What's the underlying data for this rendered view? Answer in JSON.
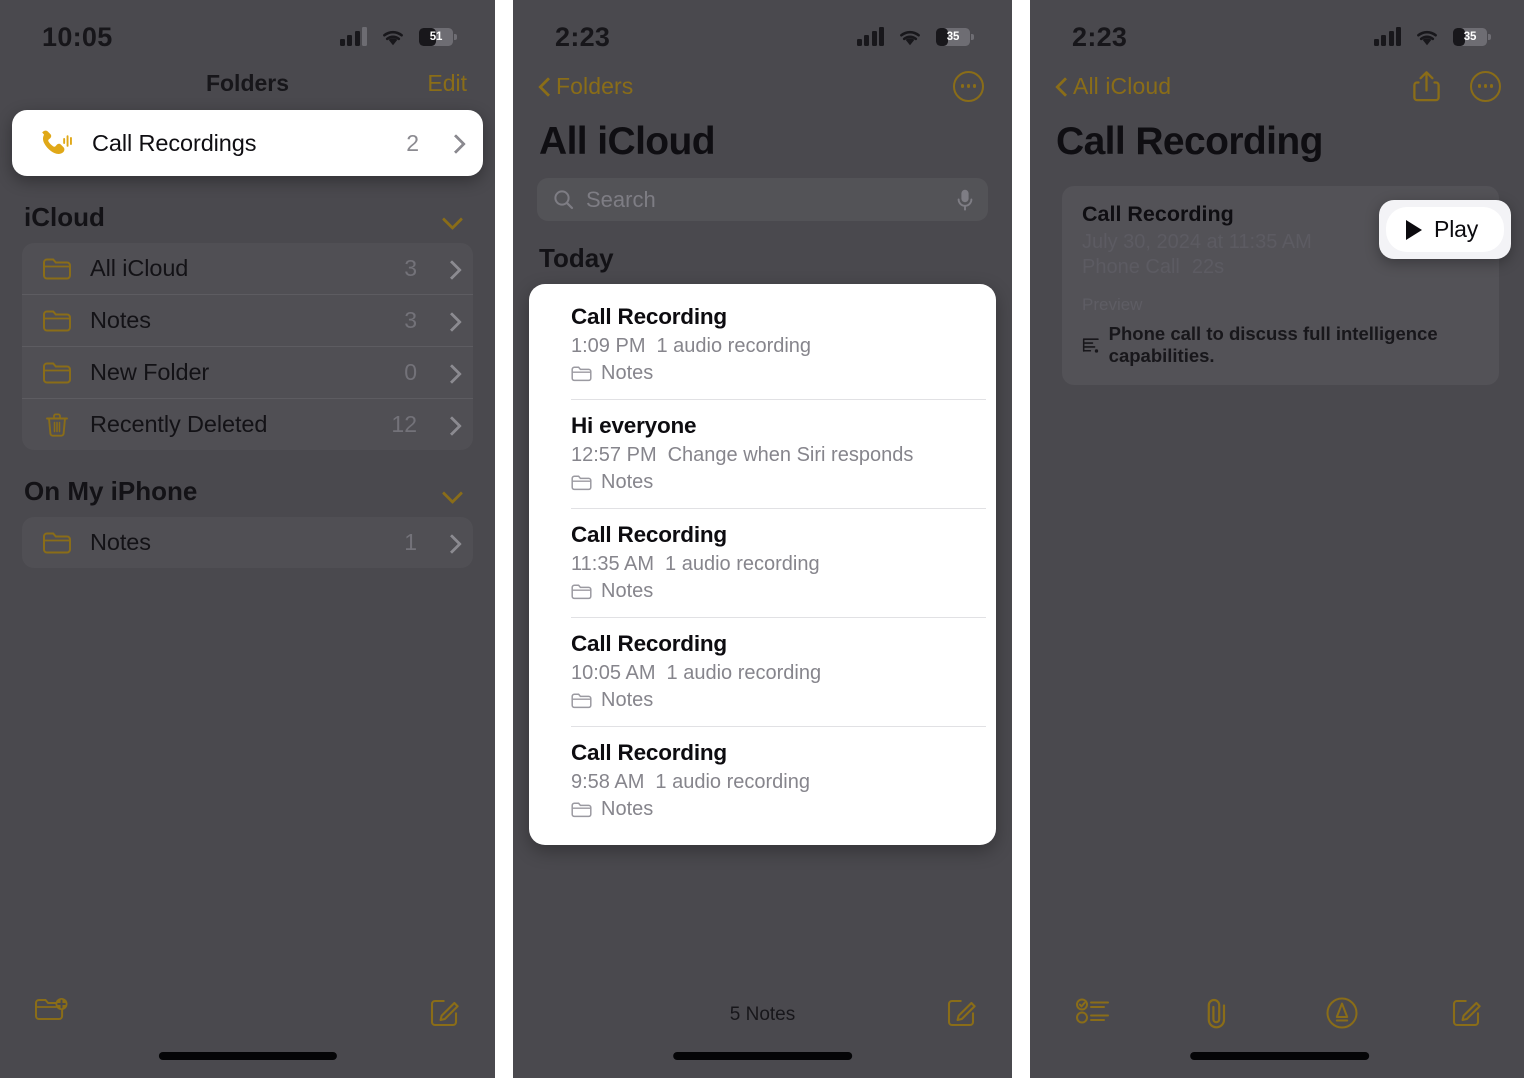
{
  "colors": {
    "dim_background": "#4a494e",
    "accent_gold": "#8a6d18",
    "call_icon": "#e0a818",
    "card_white": "#ffffff",
    "secondary_text": "#86858c"
  },
  "panel1": {
    "status": {
      "time": "10:05",
      "battery_level": "51",
      "battery_pct": 51,
      "signal_bars": 3,
      "wifi": "wifi-icon"
    },
    "nav": {
      "title": "Folders",
      "edit_label": "Edit"
    },
    "highlight": {
      "icon": "call-recording-icon",
      "label": "Call Recordings",
      "count": "2",
      "chevron": "chevron-right-icon"
    },
    "sections": [
      {
        "title": "iCloud",
        "chevron": "chevron-down-icon",
        "rows": [
          {
            "icon": "folder-icon",
            "label": "All iCloud",
            "count": "3"
          },
          {
            "icon": "folder-icon",
            "label": "Notes",
            "count": "3"
          },
          {
            "icon": "folder-icon",
            "label": "New Folder",
            "count": "0"
          },
          {
            "icon": "trash-icon",
            "label": "Recently Deleted",
            "count": "12"
          }
        ]
      },
      {
        "title": "On My iPhone",
        "chevron": "chevron-down-icon",
        "rows": [
          {
            "icon": "folder-icon",
            "label": "Notes",
            "count": "1"
          }
        ]
      }
    ],
    "bottom": {
      "left_icon": "new-folder-icon",
      "right_icon": "compose-icon"
    }
  },
  "panel2": {
    "status": {
      "time": "2:23",
      "battery_level": "35",
      "battery_pct": 35,
      "signal_bars": 4,
      "wifi": "wifi-icon"
    },
    "nav": {
      "back_label": "Folders",
      "back_icon": "chevron-left-icon",
      "more_icon": "ellipsis-circle-icon"
    },
    "title": "All iCloud",
    "search": {
      "placeholder": "Search",
      "icon": "search-icon",
      "mic_icon": "microphone-icon"
    },
    "group_header": "Today",
    "notes": [
      {
        "title": "Call Recording",
        "time": "1:09 PM",
        "snippet": "1 audio recording",
        "folder": "Notes",
        "folder_icon": "folder-icon"
      },
      {
        "title": "Hi everyone",
        "time": "12:57 PM",
        "snippet": "Change when Siri responds",
        "folder": "Notes",
        "folder_icon": "folder-icon"
      },
      {
        "title": "Call Recording",
        "time": "11:35 AM",
        "snippet": "1 audio recording",
        "folder": "Notes",
        "folder_icon": "folder-icon"
      },
      {
        "title": "Call Recording",
        "time": "10:05 AM",
        "snippet": "1 audio recording",
        "folder": "Notes",
        "folder_icon": "folder-icon"
      },
      {
        "title": "Call Recording",
        "time": "9:58 AM",
        "snippet": "1 audio recording",
        "folder": "Notes",
        "folder_icon": "folder-icon"
      }
    ],
    "bottom": {
      "count_label": "5 Notes",
      "right_icon": "compose-icon"
    }
  },
  "panel3": {
    "status": {
      "time": "2:23",
      "battery_level": "35",
      "battery_pct": 35,
      "signal_bars": 4,
      "wifi": "wifi-icon"
    },
    "nav": {
      "back_label": "All iCloud",
      "back_icon": "chevron-left-icon",
      "share_icon": "share-icon",
      "more_icon": "ellipsis-circle-icon"
    },
    "title": "Call Recording",
    "recording": {
      "title": "Call Recording",
      "date": "July 30, 2024 at 11:35 AM",
      "kind": "Phone Call",
      "duration": "22s",
      "preview_label": "Preview",
      "preview_icon": "transcript-icon",
      "preview_text": "Phone call to discuss full intelligence capabilities."
    },
    "play_button": {
      "label": "Play",
      "icon": "play-triangle-icon"
    },
    "bottom": {
      "icons": [
        "checklist-icon",
        "paperclip-icon",
        "markup-pen-icon",
        "compose-icon"
      ]
    }
  }
}
